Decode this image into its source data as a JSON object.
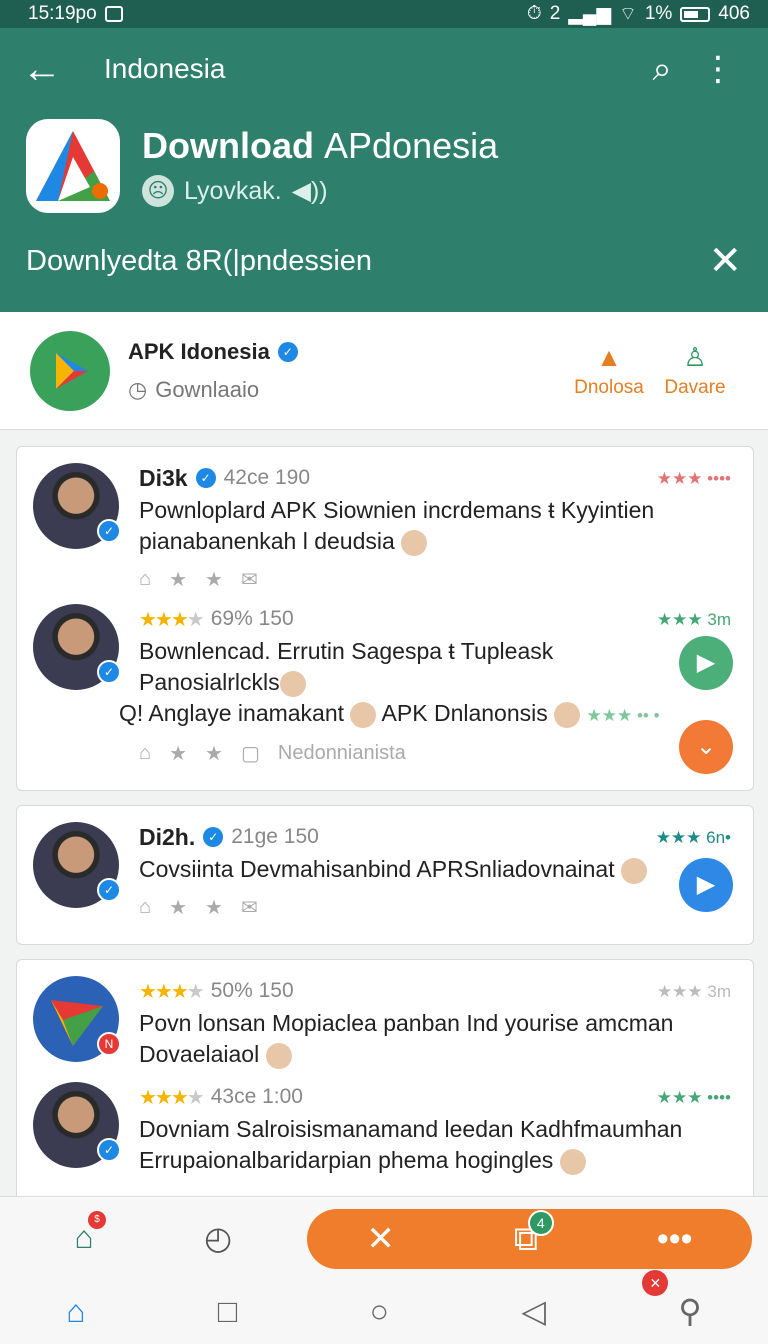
{
  "status_bar": {
    "time": "15:19po",
    "right": "2",
    "battery": "1%",
    "network": "406"
  },
  "toolbar": {
    "back_icon": "←",
    "title": "Indonesia",
    "search_icon": "⌕",
    "menu_icon": "⋮"
  },
  "app": {
    "title_bold": "Download ",
    "title_thin": "APdonesia",
    "subtitle": "Lyovkak."
  },
  "banner": {
    "text": "Downlyedta 8R(|pndessien",
    "close_icon": "✕"
  },
  "publisher": {
    "name": "APK Idonesia",
    "subtitle": "Gownlaaio",
    "action_1": "Dnolosa",
    "action_2": "Davare"
  },
  "feed": {
    "card_1": {
      "post_1": {
        "name": "Di3k",
        "meta": "42ce 190",
        "rating": "★★★ ••••",
        "text_line_1": "Pownloplard APK Siownien incrdemans ŧ Kyyintien",
        "text_line_2": "pianabanenkah l deudsia"
      },
      "post_2": {
        "meta": "69% 150",
        "rating": "★★★ 3m",
        "text_line_1": "Bownlencad. Errutin Sagespa ŧ Tupleask",
        "text_line_2": "Panosialrlckls",
        "text_line_3_a": "Anglaye inamakant",
        "text_line_3_b": "APK Dnlanonsis",
        "extra_rating": "★★★ •• •",
        "action_label": "Nedonnianista"
      }
    },
    "card_2": {
      "post_1": {
        "name": "Di2h.",
        "meta": "21ge 150",
        "rating": "★★★ 6n•",
        "text_line_1": "Covsiinta Devmahisanbind APRSnliadovnainat"
      }
    },
    "card_3": {
      "post_1": {
        "meta": "50% 150",
        "rating": "★★★ 3m",
        "text_line_1": "Povn lonsan Mopiaclea panban Ind yourise amcman",
        "text_line_2": "Dovaelaiaol"
      },
      "post_2": {
        "meta": "43ce 1:00",
        "rating": "★★★ ••••",
        "text_line_1": "Dovniam Salroisismanamand leedan Kadhfmaumhan",
        "text_line_2": "Errupaionalbaridarpian phema hogingles"
      }
    }
  },
  "action_bar": {
    "pill_badge": "4"
  },
  "colors": {
    "primary": "#2e7f6c",
    "accent": "#ef7d2b",
    "link": "#1e88e5"
  }
}
